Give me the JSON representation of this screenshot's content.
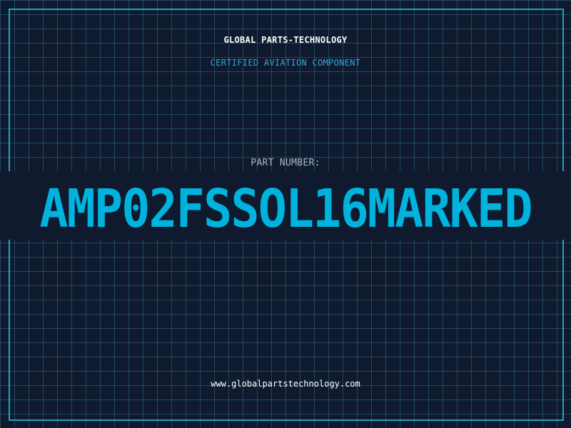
{
  "header": {
    "company": "GLOBAL PARTS-TECHNOLOGY",
    "subtitle": "CERTIFIED AVIATION COMPONENT"
  },
  "part": {
    "label": "PART NUMBER:",
    "number": "AMP02FSSOL16MARKED"
  },
  "footer": {
    "website": "www.globalpartstechnology.com"
  },
  "colors": {
    "background": "#0f1a2e",
    "grid": "#2e6e82",
    "frame": "#1fa3c9",
    "accent": "#00b3dd",
    "label": "#aab7c6",
    "text": "#ffffff"
  }
}
